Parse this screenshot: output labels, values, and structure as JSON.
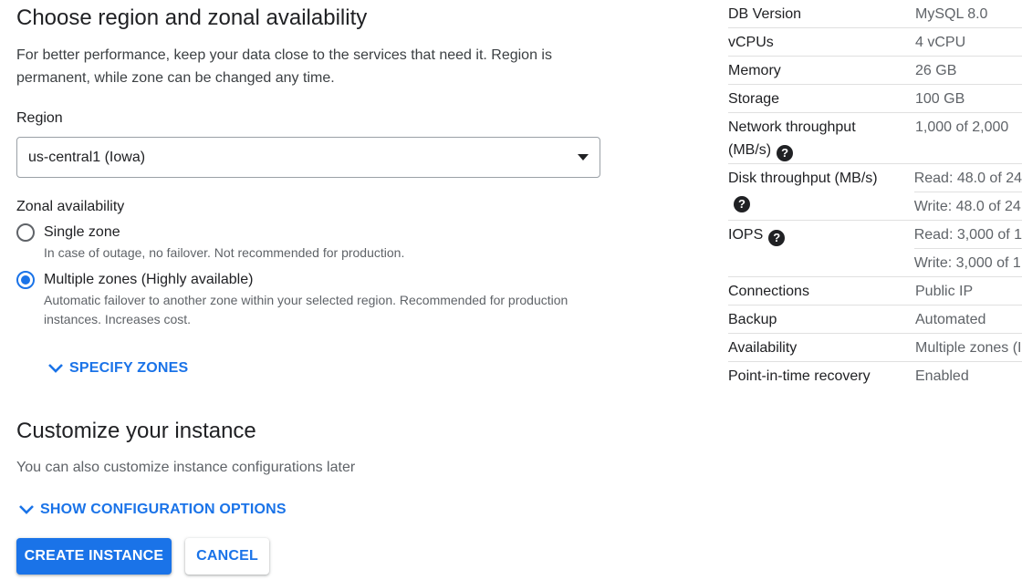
{
  "region_section": {
    "title": "Choose region and zonal availability",
    "description": "For better performance, keep your data close to the services that need it. Region is permanent, while zone can be changed any time.",
    "region_label": "Region",
    "region_value": "us-central1 (Iowa)",
    "zonal_label": "Zonal availability",
    "options": [
      {
        "label": "Single zone",
        "help": "In case of outage, no failover. Not recommended for production.",
        "checked": false
      },
      {
        "label": "Multiple zones (Highly available)",
        "help": "Automatic failover to another zone within your selected region. Recommended for production instances. Increases cost.",
        "checked": true
      }
    ],
    "specify_zones": "SPECIFY ZONES"
  },
  "customize_section": {
    "title": "Customize your instance",
    "subtitle": "You can also customize instance configurations later",
    "show_options": "SHOW CONFIGURATION OPTIONS"
  },
  "actions": {
    "create": "CREATE INSTANCE",
    "cancel": "CANCEL"
  },
  "summary": {
    "rows": [
      {
        "key": "DB Version",
        "value": "MySQL 8.0"
      },
      {
        "key": "vCPUs",
        "value": "4 vCPU"
      },
      {
        "key": "Memory",
        "value": "26 GB"
      },
      {
        "key": "Storage",
        "value": "100 GB"
      },
      {
        "key": "Network throughput",
        "key2": "(MB/s)",
        "value": "1,000 of 2,000"
      },
      {
        "key": "Disk throughput (MB/s)",
        "value": "Read: 48.0 of 24",
        "value2": "Write: 48.0 of 24"
      },
      {
        "key": "IOPS",
        "value": "Read: 3,000 of 1",
        "value2": "Write: 3,000 of 1"
      },
      {
        "key": "Connections",
        "value": "Public IP"
      },
      {
        "key": "Backup",
        "value": "Automated"
      },
      {
        "key": "Availability",
        "value": "Multiple zones (I"
      },
      {
        "key": "Point-in-time recovery",
        "value": "Enabled"
      }
    ]
  },
  "colors": {
    "primary": "#1a73e8",
    "text": "#202124",
    "muted": "#5f6368"
  }
}
